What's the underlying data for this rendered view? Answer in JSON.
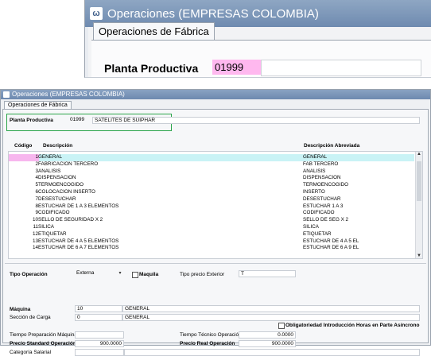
{
  "zoom": {
    "title": "Operaciones (EMPRESAS COLOMBIA)",
    "tab": "Operaciones de Fábrica",
    "planta_label": "Planta Productiva",
    "planta_value": "01999"
  },
  "window": {
    "title": "Operaciones (EMPRESAS COLOMBIA)",
    "tab": "Operaciones de Fábrica"
  },
  "planta": {
    "label": "Planta Productiva",
    "code": "01999",
    "name": "SATELITES DE SUIPHAR"
  },
  "grid": {
    "headers": {
      "codigo": "Código",
      "descripcion": "Descripción",
      "abreviada": "Descripción Abreviada"
    },
    "rows": [
      {
        "num": "1",
        "desc": "GENERAL",
        "abr": "GENERAL"
      },
      {
        "num": "2",
        "desc": "FABRICACION TERCERO",
        "abr": "FAB TERCERO"
      },
      {
        "num": "3",
        "desc": "ANALISIS",
        "abr": "ANALISIS"
      },
      {
        "num": "4",
        "desc": "DISPENSACION",
        "abr": "DISPENSACION"
      },
      {
        "num": "5",
        "desc": "TERMOENCOGIDO",
        "abr": "TERMOENCOGIDO"
      },
      {
        "num": "6",
        "desc": "COLOCACION INSERTO",
        "abr": "INSERTO"
      },
      {
        "num": "7",
        "desc": "DESESTUCHAR",
        "abr": "DESESTUCHAR"
      },
      {
        "num": "8",
        "desc": "ESTUCHAR DE 1 A 3 ELEMENTOS",
        "abr": "ESTUCHAR 1 A 3"
      },
      {
        "num": "9",
        "desc": "CODIFICADO",
        "abr": "CODIFICADO"
      },
      {
        "num": "10",
        "desc": "SELLO DE SEGURIDAD X 2",
        "abr": "SELLO DE SEG X 2"
      },
      {
        "num": "11",
        "desc": "SILICA",
        "abr": "SILICA"
      },
      {
        "num": "12",
        "desc": "ETIQUETAR",
        "abr": "ETIQUETAR"
      },
      {
        "num": "13",
        "desc": "ESTUCHAR DE 4 A 5 ELEMENTOS",
        "abr": "ESTUCHAR DE 4 A 5 EL"
      },
      {
        "num": "14",
        "desc": "ESTUCHAR DE 6 A 7 ELEMENTOS",
        "abr": "ESTUCHAR DE 6 A 9 EL"
      }
    ]
  },
  "form": {
    "tipo_operacion_label": "Tipo Operación",
    "tipo_operacion_value": "Externa",
    "maquila_label": "Maquila",
    "tipo_precio_label": "Tipo precio Exterior",
    "tipo_precio_value": "T",
    "maquina_label": "Máquina",
    "maquina_code": "10",
    "maquina_name": "GENERAL",
    "seccion_label": "Sección de Carga",
    "seccion_code": "0",
    "seccion_name": "GENERAL",
    "obligatoriedad_label": "Obligatoriedad Introducción Horas en Parte Asíncrono",
    "tiempo_prep_label": "Tiempo Preparación Máquina",
    "tiempo_tec_label": "Tiempo Técnico Operación",
    "tiempo_tec_value": "0.0000",
    "precio_std_label": "Precio Standard Operación",
    "precio_std_value": "900.0000",
    "precio_real_label": "Precio Real Operación",
    "precio_real_value": "900.0000",
    "categoria_label": "Categoría Salarial"
  },
  "colors": {
    "titlebar": "#7a94b8",
    "selection": "#c9f3f6",
    "pink_input": "#ffb8ef",
    "highlight_box": "#2aa44a"
  }
}
